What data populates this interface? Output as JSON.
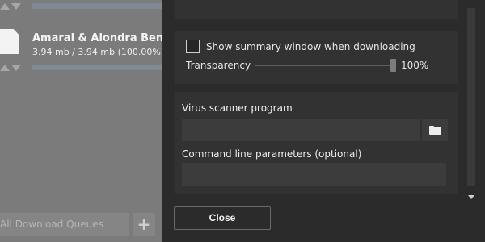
{
  "background": {
    "download": {
      "title": "Amaral & Alondra Bentley -",
      "size": "3.94 mb / 3.94 mb (100.00%)",
      "progress_percent": 100
    },
    "queue_dropdown": "All Download Queues",
    "add_queue_label": "+"
  },
  "dialog": {
    "summary_checkbox": {
      "label": "Show summary window when downloading",
      "checked": false
    },
    "transparency": {
      "label": "Transparency",
      "value": "100%",
      "level_percent": 100
    },
    "virus_scanner": {
      "label": "Virus scanner program",
      "value": ""
    },
    "command_line": {
      "label": "Command line parameters (optional)",
      "value": ""
    },
    "close_label": "Close"
  },
  "colors": {
    "dialog_bg": "#2b2b2b",
    "section_bg": "#323232",
    "input_bg": "#3c3c3c",
    "overlay_bg": "#7b7b7b"
  },
  "icons": [
    "file-icon",
    "folder-icon",
    "arrow-up-icon",
    "arrow-down-icon",
    "scroll-down-icon"
  ]
}
